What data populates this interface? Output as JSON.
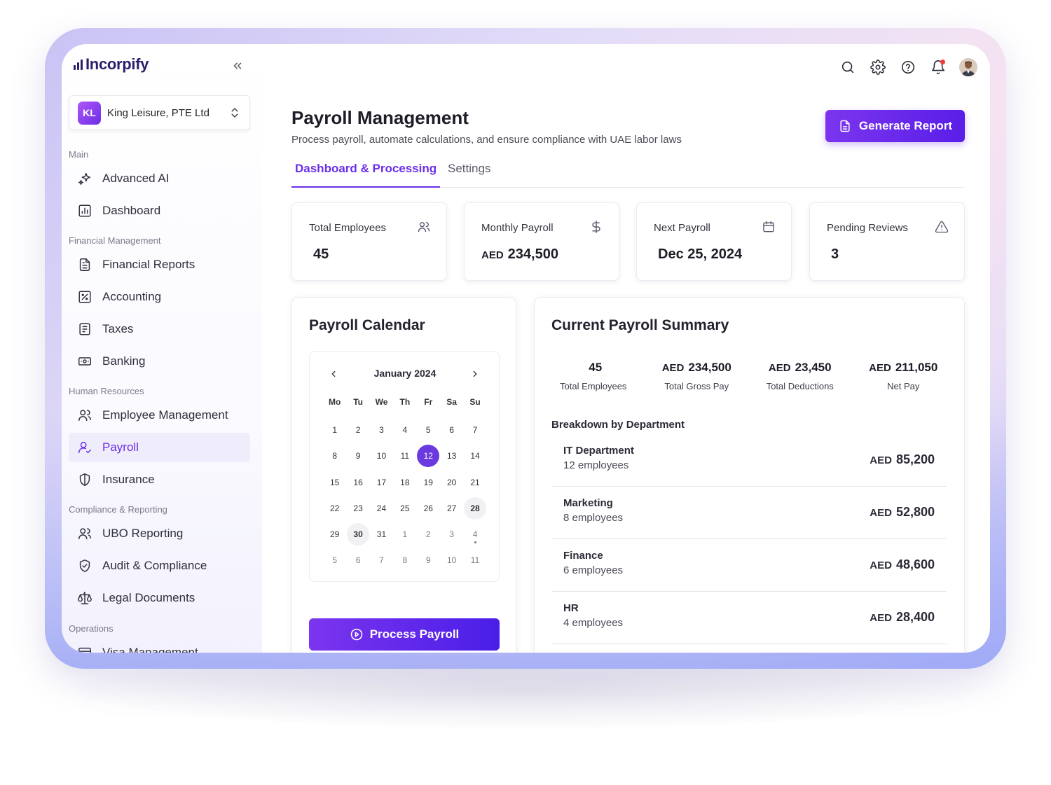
{
  "app": {
    "logo_text": "Incorpify",
    "organization": {
      "initials": "KL",
      "name": "King Leisure, PTE Ltd"
    }
  },
  "sidebar": {
    "sections": [
      {
        "label": "Main"
      },
      {
        "label": "Financial Management"
      },
      {
        "label": "Human Resources"
      },
      {
        "label": "Compliance & Reporting"
      },
      {
        "label": "Operations"
      }
    ],
    "items": [
      {
        "label": "Advanced AI",
        "icon": "sparkles-icon"
      },
      {
        "label": "Dashboard",
        "icon": "bar-chart-icon"
      },
      {
        "label": "Financial Reports",
        "icon": "file-text-icon"
      },
      {
        "label": "Accounting",
        "icon": "percent-square-icon"
      },
      {
        "label": "Taxes",
        "icon": "receipt-icon"
      },
      {
        "label": "Banking",
        "icon": "banknote-icon"
      },
      {
        "label": "Employee Management",
        "icon": "users-icon"
      },
      {
        "label": "Payroll",
        "icon": "user-check-icon",
        "active": true
      },
      {
        "label": "Insurance",
        "icon": "shield-icon"
      },
      {
        "label": "UBO Reporting",
        "icon": "users-icon"
      },
      {
        "label": "Audit & Compliance",
        "icon": "shield-check-icon"
      },
      {
        "label": "Legal Documents",
        "icon": "scale-icon"
      },
      {
        "label": "Visa Management",
        "icon": "card-icon"
      }
    ]
  },
  "header": {
    "title": "Payroll Management",
    "subtitle": "Process payroll, automate calculations, and ensure compliance with UAE labor laws",
    "generate_label": "Generate Report",
    "icons": [
      "search-icon",
      "gear-icon",
      "help-icon",
      "bell-icon",
      "avatar"
    ]
  },
  "tabs": [
    {
      "label": "Dashboard & Processing",
      "active": true
    },
    {
      "label": "Settings",
      "active": false
    }
  ],
  "stats": [
    {
      "label": "Total Employees",
      "currency": "",
      "value": "45",
      "icon": "users-icon"
    },
    {
      "label": "Monthly Payroll",
      "currency": "AED",
      "value": "234,500",
      "icon": "dollar-icon"
    },
    {
      "label": "Next Payroll",
      "currency": "",
      "value": "Dec 25, 2024",
      "icon": "calendar-icon"
    },
    {
      "label": "Pending Reviews",
      "currency": "",
      "value": "3",
      "icon": "warning-icon"
    }
  ],
  "calendar": {
    "title": "Payroll Calendar",
    "month": "January 2024",
    "weekdays": [
      "Mo",
      "Tu",
      "We",
      "Th",
      "Fr",
      "Sa",
      "Su"
    ],
    "weeks": [
      [
        {
          "d": "1"
        },
        {
          "d": "2"
        },
        {
          "d": "3"
        },
        {
          "d": "4"
        },
        {
          "d": "5"
        },
        {
          "d": "6"
        },
        {
          "d": "7"
        }
      ],
      [
        {
          "d": "8"
        },
        {
          "d": "9"
        },
        {
          "d": "10"
        },
        {
          "d": "11"
        },
        {
          "d": "12",
          "state": "selected"
        },
        {
          "d": "13"
        },
        {
          "d": "14"
        }
      ],
      [
        {
          "d": "15"
        },
        {
          "d": "16"
        },
        {
          "d": "17"
        },
        {
          "d": "18"
        },
        {
          "d": "19"
        },
        {
          "d": "20"
        },
        {
          "d": "21"
        }
      ],
      [
        {
          "d": "22"
        },
        {
          "d": "23"
        },
        {
          "d": "24"
        },
        {
          "d": "25"
        },
        {
          "d": "26"
        },
        {
          "d": "27"
        },
        {
          "d": "28",
          "state": "highlight"
        }
      ],
      [
        {
          "d": "29"
        },
        {
          "d": "30",
          "state": "highlight"
        },
        {
          "d": "31"
        },
        {
          "d": "1",
          "state": "outside"
        },
        {
          "d": "2",
          "state": "outside"
        },
        {
          "d": "3",
          "state": "outside"
        },
        {
          "d": "4",
          "state": "outside",
          "dot": true
        }
      ],
      [
        {
          "d": "5",
          "state": "outside"
        },
        {
          "d": "6",
          "state": "outside"
        },
        {
          "d": "7",
          "state": "outside"
        },
        {
          "d": "8",
          "state": "outside"
        },
        {
          "d": "9",
          "state": "outside"
        },
        {
          "d": "10",
          "state": "outside"
        },
        {
          "d": "11",
          "state": "outside"
        }
      ]
    ],
    "process_label": "Process Payroll"
  },
  "summary": {
    "title": "Current Payroll Summary",
    "stats": [
      {
        "currency": "",
        "value": "45",
        "label": "Total Employees"
      },
      {
        "currency": "AED",
        "value": "234,500",
        "label": "Total Gross Pay"
      },
      {
        "currency": "AED",
        "value": "23,450",
        "label": "Total Deductions"
      },
      {
        "currency": "AED",
        "value": "211,050",
        "label": "Net Pay"
      }
    ],
    "breakdown_title": "Breakdown by Department",
    "departments": [
      {
        "name": "IT Department",
        "employees": "12 employees",
        "currency": "AED",
        "amount": "85,200"
      },
      {
        "name": "Marketing",
        "employees": "8 employees",
        "currency": "AED",
        "amount": "52,800"
      },
      {
        "name": "Finance",
        "employees": "6 employees",
        "currency": "AED",
        "amount": "48,600"
      },
      {
        "name": "HR",
        "employees": "4 employees",
        "currency": "AED",
        "amount": "28,400"
      }
    ]
  },
  "colors": {
    "accent": "#6a2ee8",
    "accent_bg": "#efedfb",
    "notification": "#ef3b3b"
  }
}
